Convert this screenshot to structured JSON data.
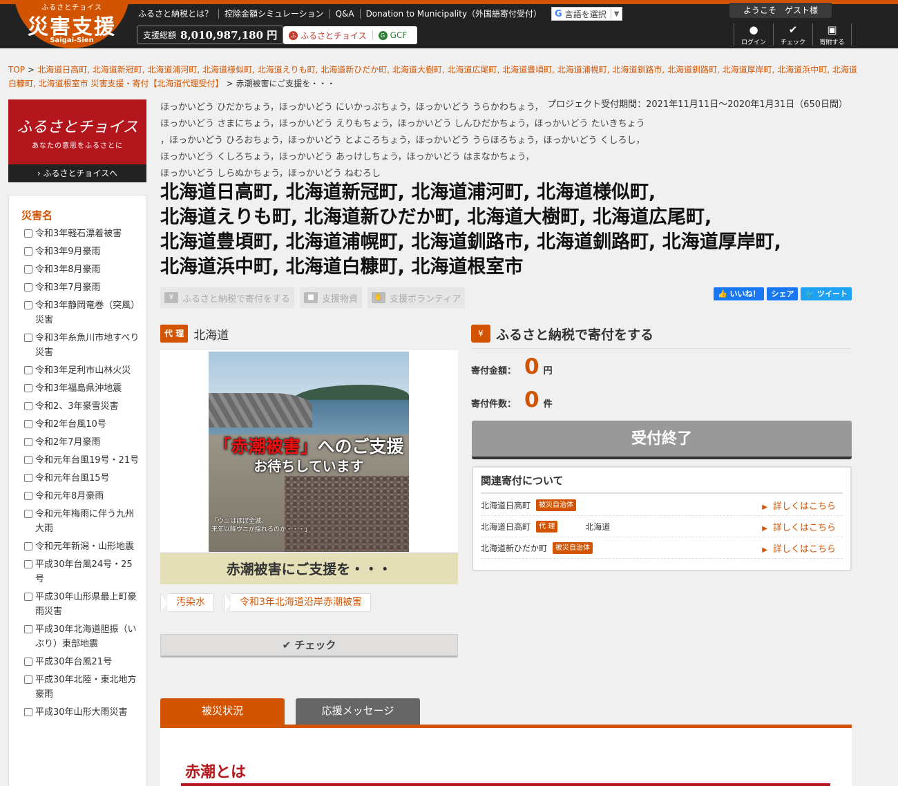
{
  "header": {
    "logo_small": "ふるさとチョイス",
    "logo_big": "災害支援",
    "logo_en": "Saigai-Sien",
    "nav": [
      "ふるさと納税とは？",
      "控除金額シミュレーション",
      "Q&A",
      "Donation to Municipality（外国語寄付受付）"
    ],
    "translate_label": "言語を選択",
    "translate_icon": "G",
    "total_label": "支援総額",
    "total_value": "8,010,987,180 円",
    "brand_choice": "ふるさとチョイス",
    "brand_gcf": "GCF",
    "welcome": "ようこそ　ゲスト様",
    "user_menu": [
      {
        "icon": "user-icon",
        "label": "ログイン"
      },
      {
        "icon": "check-icon",
        "label": "チェック"
      },
      {
        "icon": "donated-icon",
        "label": "寄附する"
      }
    ]
  },
  "breadcrumb": {
    "top": "TOP",
    "project": "北海道日高町, 北海道新冠町, 北海道浦河町, 北海道様似町, 北海道えりも町, 北海道新ひだか町, 北海道大樹町, 北海道広尾町, 北海道豊頃町, 北海道浦幌町, 北海道釧路市, 北海道釧路町, 北海道厚岸町, 北海道浜中町, 北海道白糠町, 北海道根室市 災害支援・寄付【北海道代理受付】",
    "current": "赤潮被害にご支援を・・・"
  },
  "sidebar": {
    "banner_title": "ふるさとチョイス",
    "banner_sub": "あなたの意思をふるさとに",
    "banner_link": "› ふるさとチョイスへ",
    "panel_title": "災害名",
    "disasters": [
      "令和3年軽石漂着被害",
      "令和3年9月豪雨",
      "令和3年8月豪雨",
      "令和3年7月豪雨",
      "令和3年静岡竜巻（突風）災害",
      "令和3年糸魚川市地すべり災害",
      "令和3年足利市山林火災",
      "令和3年福島県沖地震",
      "令和2、3年豪雪災害",
      "令和2年台風10号",
      "令和2年7月豪雨",
      "令和元年台風19号・21号",
      "令和元年台風15号",
      "令和元年8月豪雨",
      "令和元年梅雨に伴う九州大雨",
      "令和元年新潟・山形地震",
      "平成30年台風24号・25号",
      "平成30年山形県最上町豪雨災害",
      "平成30年北海道胆振（いぶり）東部地震",
      "平成30年台風21号",
      "平成30年北陸・東北地方豪雨",
      "平成30年山形大雨災害"
    ]
  },
  "main": {
    "kana_lines": [
      "ほっかいどう ひだかちょう，ほっかいどう にいかっぷちょう，ほっかいどう うらかわちょう，",
      "ほっかいどう さまにちょう，ほっかいどう えりもちょう，ほっかいどう しんひだかちょう，ほっかいどう たいきちょう",
      "，ほっかいどう ひろおちょう，ほっかいどう とよころちょう，ほっかいどう うらほろちょう，ほっかいどう くしろし，",
      "ほっかいどう くしろちょう，ほっかいどう あっけしちょう，ほっかいどう はまなかちょう，",
      "ほっかいどう しらぬかちょう，ほっかいどう ねむろし"
    ],
    "project_period": "プロジェクト受付期間：2021年11月11日～2020年1月31日（650日間）",
    "title_lines": [
      "北海道日高町, 北海道新冠町, 北海道浦河町, 北海道様似町,",
      "北海道えりも町, 北海道新ひだか町, 北海道大樹町, 北海道広尾町,",
      "北海道豊頃町, 北海道浦幌町, 北海道釧路市, 北海道釧路町, 北海道厚岸町,",
      "北海道浜中町, 北海道白糠町, 北海道根室市"
    ],
    "action_tags": [
      "ふるさと納税で寄付をする",
      "支援物資",
      "支援ボランティア"
    ],
    "social": {
      "like": "👍 いいね！",
      "share": "シェア",
      "tweet": "🐦 ツイート"
    },
    "proxy_badge": "代 理",
    "proxy_name": "北海道",
    "hero": {
      "caption_red": "「赤潮被害」",
      "caption_rest": "へのご支援",
      "caption2": "お待ちしています",
      "quote_1": "「ウニはほぼ全滅、",
      "quote_2": "来年以降ウニが採れるのか・・・」"
    },
    "hero_title": "赤潮被害にご支援を・・・",
    "keywords": [
      "汚染水",
      "令和3年北海道沿岸赤潮被害"
    ],
    "check_button": "✔ チェック",
    "tabs": [
      "被災状況",
      "応援メッセージ"
    ],
    "section_heading": "赤潮とは"
  },
  "donation": {
    "title": "ふるさと納税で寄付をする",
    "amount_label": "寄付金額：",
    "amount_value": "0",
    "amount_unit": "円",
    "count_label": "寄付件数：",
    "count_value": "0",
    "count_unit": "件",
    "closed_label": "受付終了",
    "related_title": "関連寄付について",
    "related": [
      {
        "name": "北海道日高町",
        "badge": "被災自治体",
        "extra": "",
        "link": "詳しくはこちら"
      },
      {
        "name": "北海道日高町",
        "badge": "代 理",
        "extra": "北海道",
        "link": "詳しくはこちら"
      },
      {
        "name": "北海道新ひだか町",
        "badge": "被災自治体",
        "extra": "",
        "link": "詳しくはこちら"
      }
    ]
  }
}
